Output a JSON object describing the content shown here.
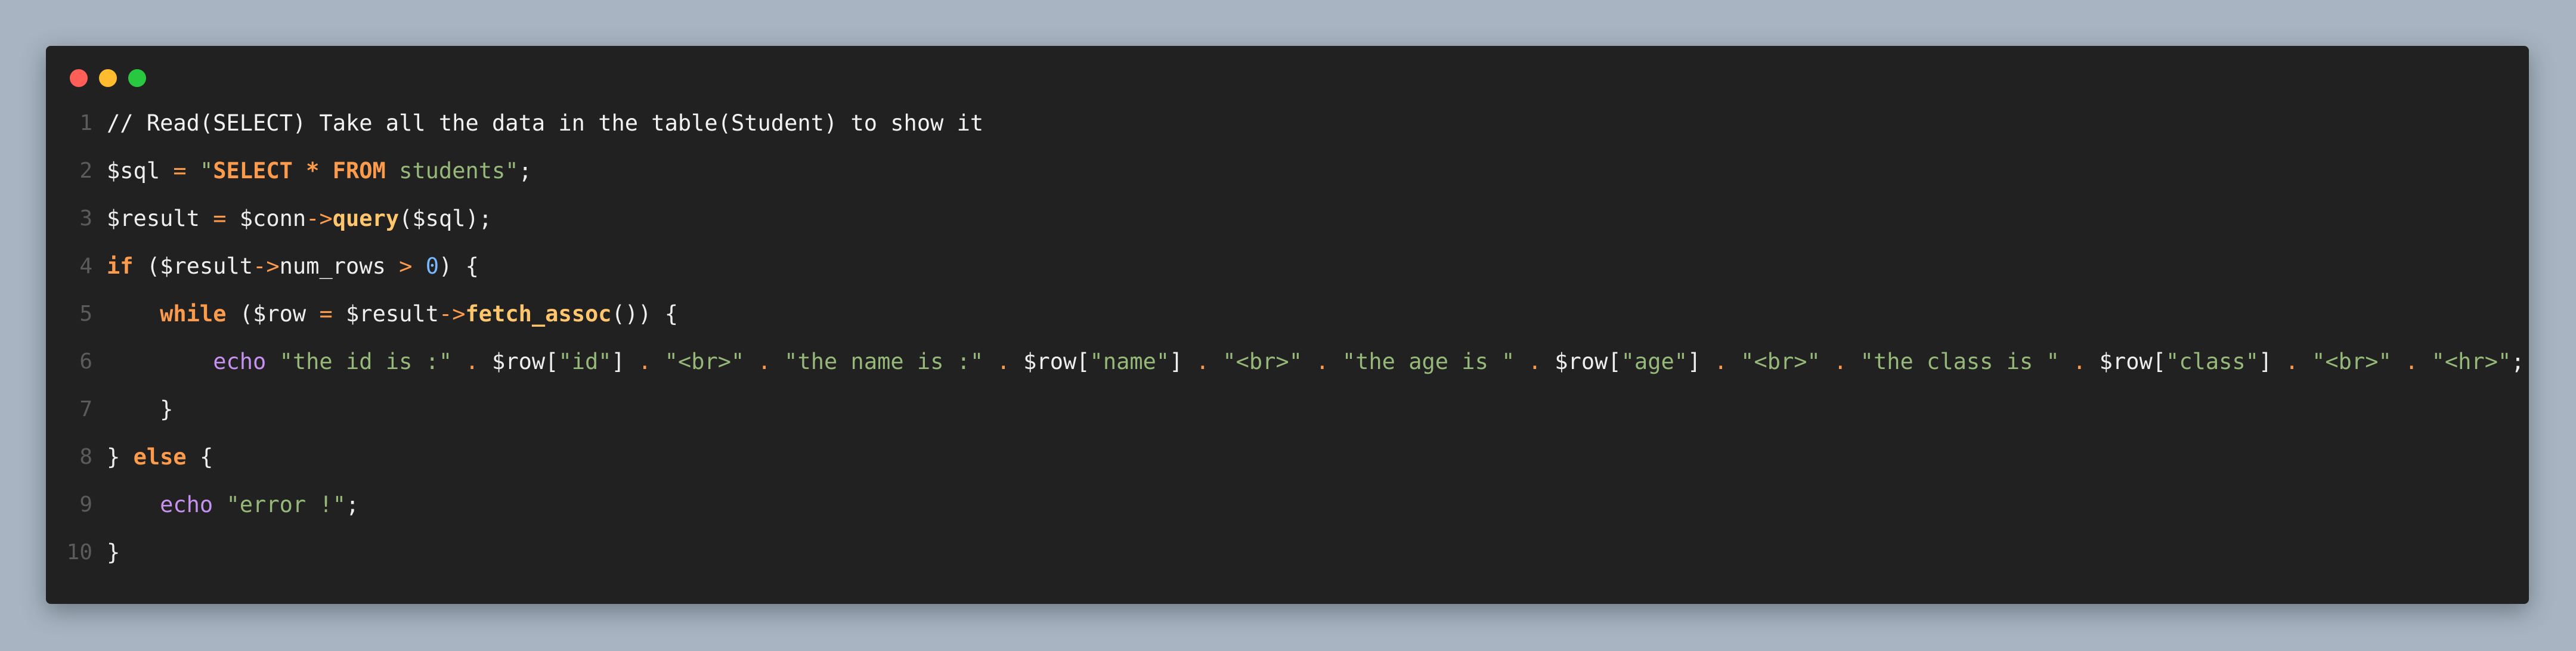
{
  "window": {
    "traffic_lights": [
      {
        "name": "close",
        "color": "#ff5f57"
      },
      {
        "name": "minimize",
        "color": "#febc2e"
      },
      {
        "name": "zoom",
        "color": "#28c840"
      }
    ]
  },
  "code": {
    "language": "php",
    "lines": [
      {
        "number": "1",
        "text": "// Read(SELECT) Take all the data in the table(Student) to show it"
      },
      {
        "number": "2",
        "text": "$sql = \"SELECT * FROM students\";"
      },
      {
        "number": "3",
        "text": "$result = $conn->query($sql);"
      },
      {
        "number": "4",
        "text": "if ($result->num_rows > 0) {"
      },
      {
        "number": "5",
        "text": "    while ($row = $result->fetch_assoc()) {"
      },
      {
        "number": "6",
        "text": "        echo \"the id is :\" . $row[\"id\"] . \"<br>\" . \"the name is :\" . $row[\"name\"] . \"<br>\" . \"the age is \" . $row[\"age\"] . \"<br>\" . \"the class is \" . $row[\"class\"] . \"<br>\" . \"<hr>\";"
      },
      {
        "number": "7",
        "text": "    }"
      },
      {
        "number": "8",
        "text": "} else {"
      },
      {
        "number": "9",
        "text": "    echo \"error !\";"
      },
      {
        "number": "10",
        "text": "}"
      }
    ]
  }
}
